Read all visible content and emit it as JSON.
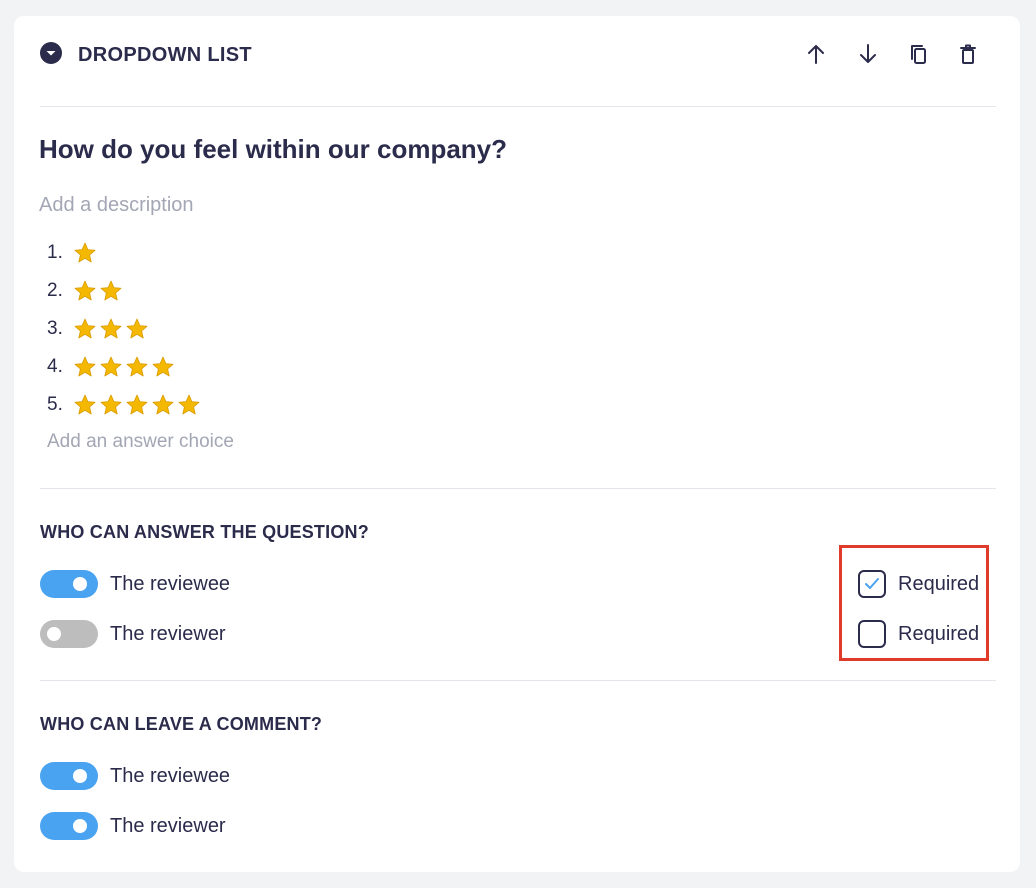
{
  "header": {
    "title": "DROPDOWN LIST",
    "icon": "chevron-circle-down-icon",
    "tools": [
      "arrow-up-icon",
      "arrow-down-icon",
      "copy-icon",
      "trash-icon"
    ]
  },
  "question": {
    "title": "How do you feel within our company?",
    "description_placeholder": "Add a description"
  },
  "choices": [
    {
      "number": "1.",
      "stars": 1
    },
    {
      "number": "2.",
      "stars": 2
    },
    {
      "number": "3.",
      "stars": 3
    },
    {
      "number": "4.",
      "stars": 4
    },
    {
      "number": "5.",
      "stars": 5
    }
  ],
  "add_choice_placeholder": "Add an answer choice",
  "answer_section": {
    "title": "WHO CAN ANSWER THE QUESTION?",
    "rows": [
      {
        "label": "The reviewee",
        "enabled": true,
        "required_label": "Required",
        "required": true
      },
      {
        "label": "The reviewer",
        "enabled": false,
        "required_label": "Required",
        "required": false
      }
    ]
  },
  "comment_section": {
    "title": "WHO CAN LEAVE A COMMENT?",
    "rows": [
      {
        "label": "The reviewee",
        "enabled": true
      },
      {
        "label": "The reviewer",
        "enabled": true
      }
    ]
  },
  "colors": {
    "accent": "#4aa3f0",
    "text": "#2b2b4b",
    "placeholder": "#a3a6b4",
    "toggle_off": "#bdbdbd",
    "highlight": "#e03a2b",
    "star": "#f5b800"
  }
}
